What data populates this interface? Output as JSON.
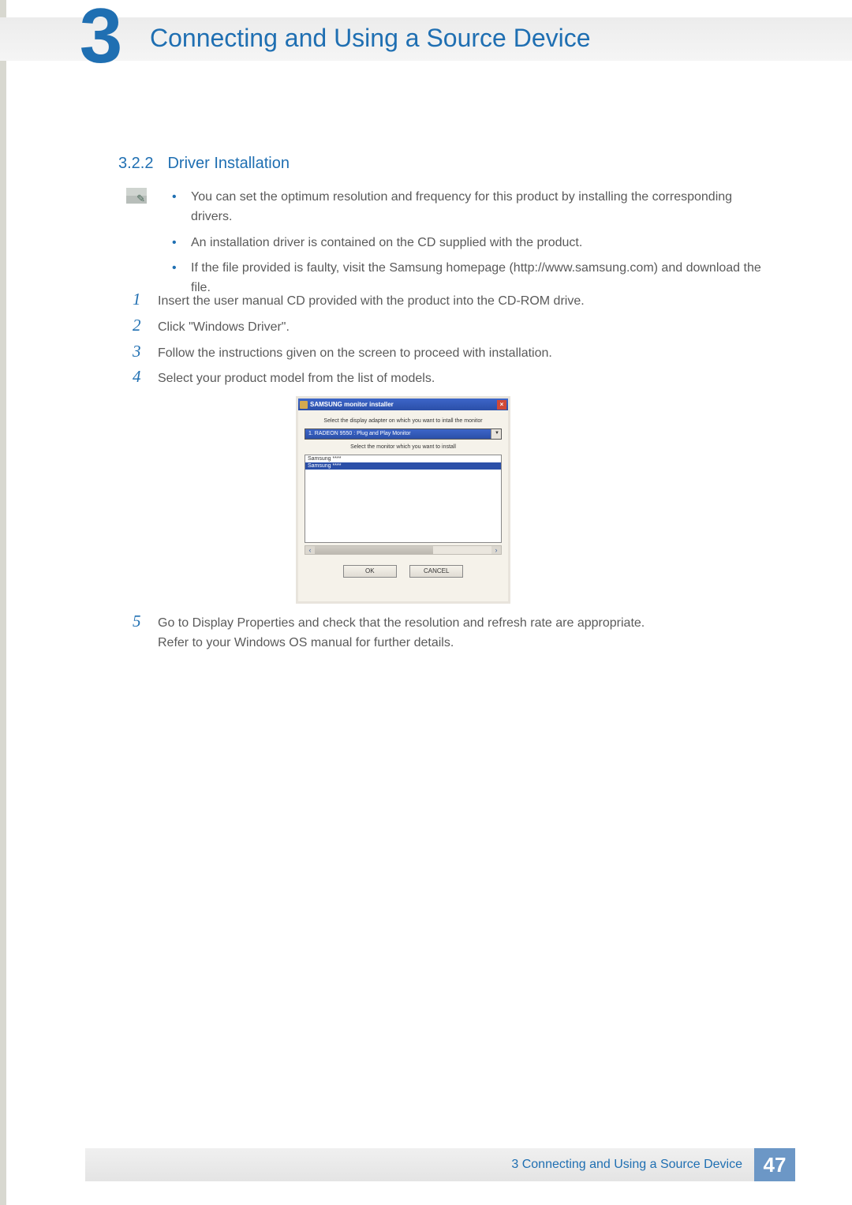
{
  "header": {
    "chapter_number": "3",
    "chapter_title": "Connecting and Using a Source Device"
  },
  "section": {
    "number": "3.2.2",
    "title": "Driver Installation"
  },
  "note_bullets": [
    "You can set the optimum resolution and frequency for this product by installing the corresponding drivers.",
    "An installation driver is contained on the CD supplied with the product.",
    "If the file provided is faulty, visit the Samsung homepage (http://www.samsung.com) and download the file."
  ],
  "steps": {
    "s1": {
      "num": "1",
      "text": "Insert the user manual CD provided with the product into the CD-ROM drive."
    },
    "s2": {
      "num": "2",
      "text": "Click \"Windows Driver\"."
    },
    "s3": {
      "num": "3",
      "text": "Follow the instructions given on the screen to proceed with installation."
    },
    "s4": {
      "num": "4",
      "text": "Select your product model from the list of models."
    },
    "s5": {
      "num": "5",
      "text_a": "Go to Display Properties and check that the resolution and refresh rate are appropriate.",
      "text_b": "Refer to your Windows OS manual for further details."
    }
  },
  "installer": {
    "title": "SAMSUNG monitor installer",
    "close": "×",
    "prompt1": "Select the display adapter on which you want to intall the monitor",
    "adapter": "1. RADEON 9550 : Plug and Play Monitor",
    "prompt2": "Select the monitor which you want to install",
    "monitor_row1": "Samsung ****",
    "monitor_row2": "Samsung ****",
    "ok": "OK",
    "cancel": "CANCEL"
  },
  "footer": {
    "text": "3 Connecting and Using a Source Device",
    "page": "47"
  }
}
